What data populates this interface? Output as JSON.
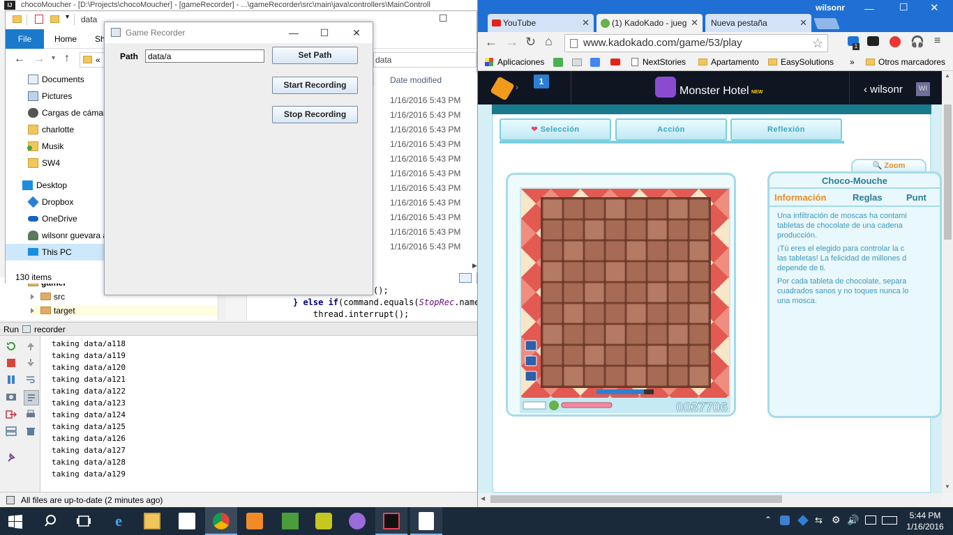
{
  "ide": {
    "title": "chocoMoucher - [D:\\Projects\\chocoMoucher] - [gameRecorder] - ...\\gameRecorder\\src\\main\\java\\controllers\\MainControll",
    "tree": {
      "parent": "gamer",
      "src": "src",
      "target": "target"
    },
    "code": {
      "line1": "();",
      "else": "} else if",
      "cmd": "(command.equals(",
      "stoprec": "StopRec",
      "name": ".name",
      "line3": "thread.interrupt();"
    },
    "run_tab": {
      "run": "Run",
      "name": "recorder"
    },
    "console_lines": [
      "taking data/a118",
      "taking data/a119",
      "taking data/a120",
      "taking data/a121",
      "taking data/a122",
      "taking data/a123",
      "taking data/a124",
      "taking data/a125",
      "taking data/a126",
      "taking data/a127",
      "taking data/a128",
      "taking data/a129"
    ],
    "status": "All files are up-to-date (2 minutes ago)"
  },
  "explorer": {
    "title": "data",
    "ribbon": {
      "file": "File",
      "home": "Home",
      "share": "Sh"
    },
    "address_short": "«",
    "address_right": "data",
    "nav_items": [
      "Documents",
      "Pictures",
      "Cargas de cámara",
      "charlotte",
      "Musik",
      "SW4",
      "Desktop",
      "Dropbox",
      "OneDrive",
      "wilsonr guevara a",
      "This PC"
    ],
    "column_date": "Date modified",
    "dates": [
      "1/16/2016 5:43 PM",
      "1/16/2016 5:43 PM",
      "1/16/2016 5:43 PM",
      "1/16/2016 5:43 PM",
      "1/16/2016 5:43 PM",
      "1/16/2016 5:43 PM",
      "1/16/2016 5:43 PM",
      "1/16/2016 5:43 PM",
      "1/16/2016 5:43 PM",
      "1/16/2016 5:43 PM",
      "1/16/2016 5:43 PM"
    ],
    "item_count": "130 items"
  },
  "recorder": {
    "title": "Game Recorder",
    "path_label": "Path",
    "path_value": "data/a",
    "set_path": "Set Path",
    "start": "Start Recording",
    "stop": "Stop Recording"
  },
  "chrome": {
    "user": "wilsonr",
    "tabs": [
      {
        "label": "YouTube",
        "active": false
      },
      {
        "label": "(1) KadoKado - jueg",
        "active": true
      },
      {
        "label": "Nueva pestaña",
        "active": false
      }
    ],
    "url": "www.kadokado.com/game/53/play",
    "bookmarks": {
      "apps": "Aplicaciones",
      "nextstories": "NextStories",
      "apartamento": "Apartamento",
      "easysolutions": "EasySolutions",
      "more": "»",
      "otros": "Otros marcadores"
    },
    "extension_badge": "1"
  },
  "kadokado": {
    "notif_count": "1",
    "game_name": "Monster Hotel",
    "game_badge": "NEW",
    "user": "wilsonr",
    "user_short": "WI",
    "game_tabs": [
      "Selección",
      "Acción",
      "Reflexión"
    ],
    "zoom": "Zoom",
    "game_title": "Choco-Mouche",
    "info_tabs": [
      "Información",
      "Reglas",
      "Punt"
    ],
    "description": [
      "Una infiltración de moscas ha contami",
      "tabletas de chocolate de una cadena",
      "producción.",
      "¡Tú eres el elegido para controlar la c",
      "las tabletas! La felicidad de millones d",
      "depende de ti.",
      "Por cada tableta de chocolate, separa",
      "cuadrados sanos y no toques nunca lo",
      "una mosca."
    ],
    "score": "0037706",
    "lives": 3
  },
  "taskbar": {
    "time": "5:44 PM",
    "date": "1/16/2016"
  },
  "colors": {
    "taskbar": "#1b2a3a",
    "chrome_tab_bar": "#1f6fd4",
    "info_orange": "#ef8a1e",
    "info_blue": "#3d98b8"
  }
}
